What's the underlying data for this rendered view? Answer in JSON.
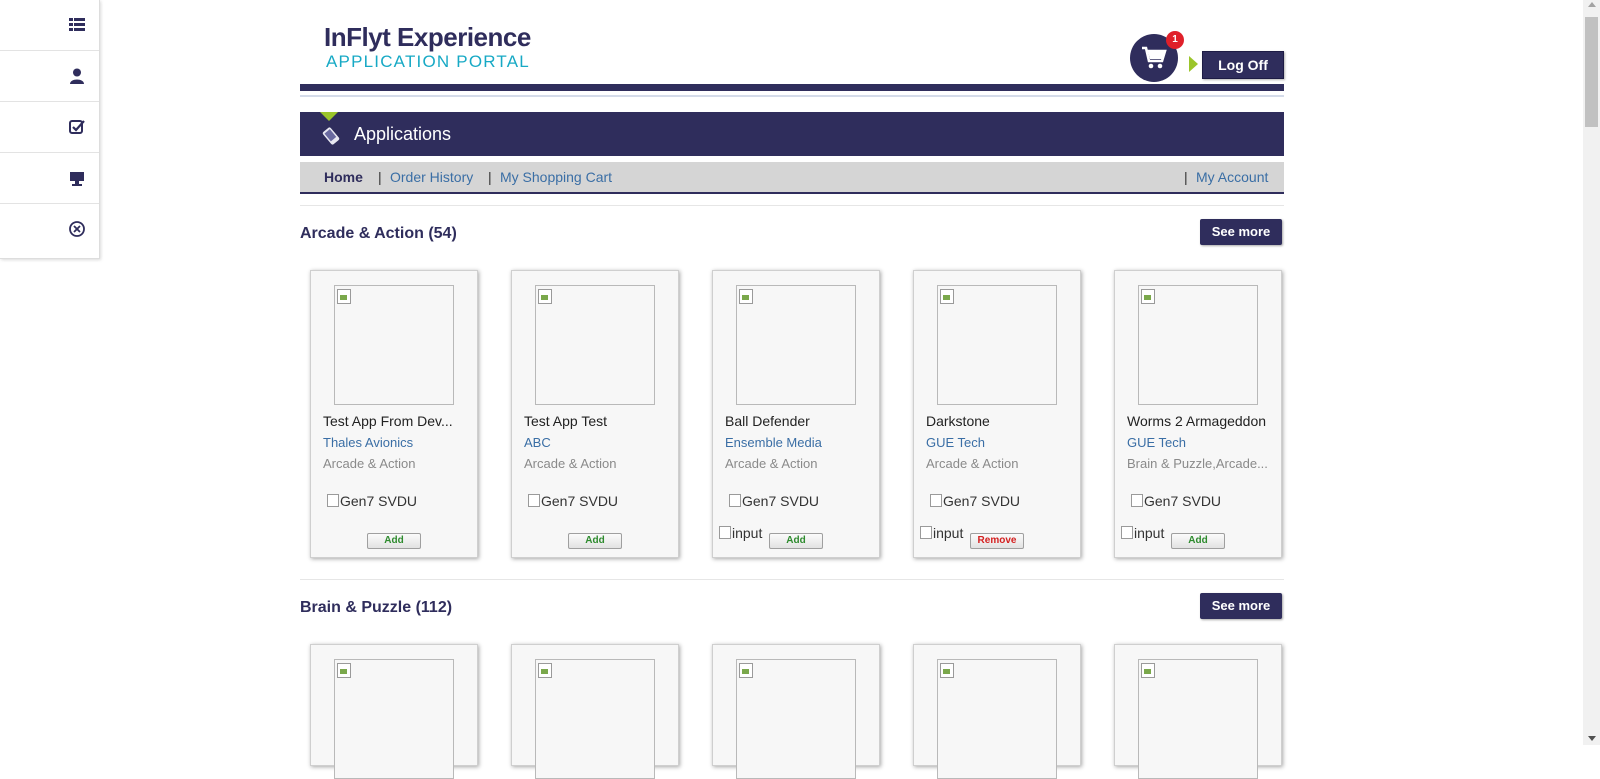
{
  "sidebar": {
    "items": [
      {
        "icon": "list-icon"
      },
      {
        "icon": "user-icon"
      },
      {
        "icon": "checklist-icon"
      },
      {
        "icon": "monitor-icon"
      },
      {
        "icon": "close-circle-icon"
      }
    ]
  },
  "header": {
    "logo_line1": "InFlyt Experience",
    "logo_line2": "APPLICATION PORTAL",
    "cart_count": "1",
    "logoff_label": "Log Off"
  },
  "appbar": {
    "title": "Applications"
  },
  "nav": {
    "home": "Home",
    "sep": "|",
    "order_history": "Order History",
    "shopping_cart": "My Shopping Cart",
    "my_account": "My Account"
  },
  "sections": [
    {
      "title": "Arcade & Action (54)",
      "see_more": "See more",
      "apps": [
        {
          "name": "Test App From Dev...",
          "developer": "Thales Avionics",
          "category": "Arcade & Action",
          "platform": "Gen7 SVDU",
          "input": "",
          "action": "Add"
        },
        {
          "name": "Test App Test",
          "developer": "ABC",
          "category": "Arcade & Action",
          "platform": "Gen7 SVDU",
          "input": "",
          "action": "Add"
        },
        {
          "name": "Ball Defender",
          "developer": "Ensemble Media",
          "category": "Arcade & Action",
          "platform": "Gen7 SVDU",
          "input": "input",
          "action": "Add"
        },
        {
          "name": "Darkstone",
          "developer": "GUE Tech",
          "category": "Arcade & Action",
          "platform": "Gen7 SVDU",
          "input": "input",
          "action": "Remove"
        },
        {
          "name": "Worms 2 Armageddon",
          "developer": "GUE Tech",
          "category": "Brain & Puzzle,Arcade...",
          "platform": "Gen7 SVDU",
          "input": "input",
          "action": "Add"
        }
      ]
    },
    {
      "title": "Brain & Puzzle (112)",
      "see_more": "See more"
    }
  ],
  "colors": {
    "brand": "#2f2d5c",
    "accent": "#9bc52b",
    "link": "#3a6ea5",
    "badge": "#e0202a"
  }
}
